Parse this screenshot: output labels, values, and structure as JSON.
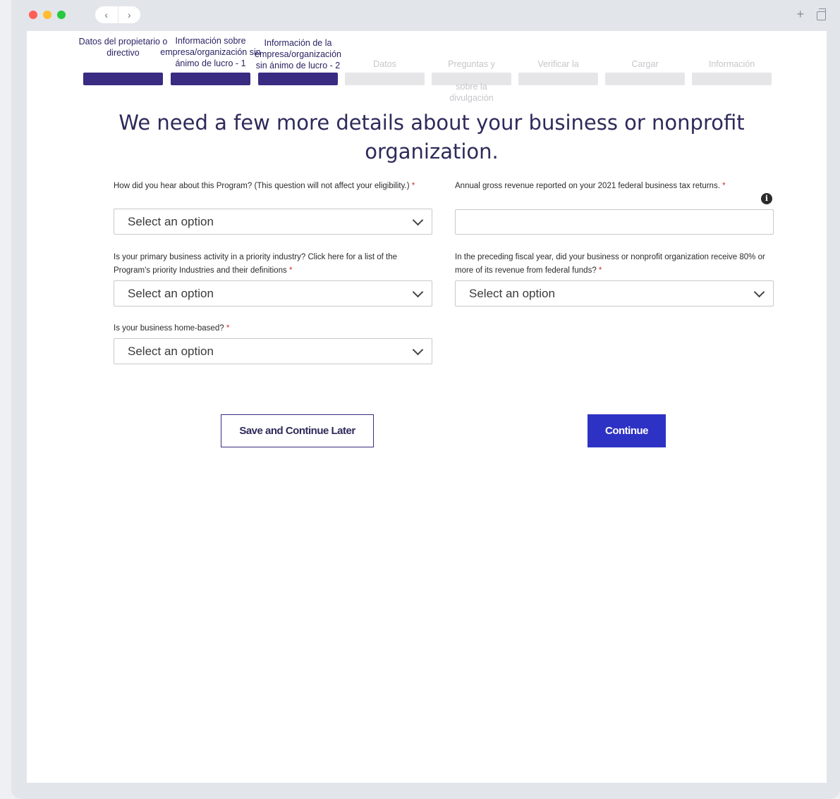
{
  "browser": {
    "back_icon": "chevron-left",
    "forward_icon": "chevron-right",
    "new_tab_icon": "plus",
    "tabs_icon": "tabs-overview"
  },
  "stepper": {
    "steps": [
      {
        "label": "Datos del propietario o directivo",
        "state": "completed"
      },
      {
        "label": "Información sobre empresa/organización sin ánimo de lucro - 1",
        "state": "completed"
      },
      {
        "label": "Información de la empresa/organización sin ánimo de lucro - 2",
        "state": "current"
      },
      {
        "label": "Datos",
        "state": "upcoming"
      },
      {
        "label": "Preguntas y ... sobre la divulgación",
        "state": "upcoming"
      },
      {
        "label": "Verificar la",
        "state": "upcoming"
      },
      {
        "label": "Cargar",
        "state": "upcoming"
      },
      {
        "label": "Información",
        "state": "upcoming"
      }
    ],
    "step5_line1": "Preguntas y",
    "step5_line2": "sobre la",
    "step5_line3": "divulgación",
    "active_color": "#3a2b82",
    "inactive_color": "#e6e6e9"
  },
  "form": {
    "title": "We need a few more details about your business or nonprofit organization.",
    "hear_about": {
      "label": "How did you hear about this Program? (This question will not affect your eligibility.)",
      "required_mark": "*",
      "value": "Select an option"
    },
    "gross_revenue": {
      "label": "Annual gross revenue reported on your 2021 federal business tax returns.",
      "required_mark": "*",
      "value": "",
      "info_icon": "info-circle"
    },
    "priority_industry": {
      "label": "Is your primary business activity in a priority industry? Click here for a list of the Program's priority Industries and their definitions",
      "required_mark": "*",
      "value": "Select an option"
    },
    "federal_funds": {
      "label": "In the preceding fiscal year, did your business or nonprofit organization receive 80% or more of its revenue from federal funds?",
      "required_mark": "*",
      "value": "Select an option"
    },
    "home_based": {
      "label": "Is your business home-based?",
      "required_mark": "*",
      "value": "Select an option"
    }
  },
  "actions": {
    "save_later": "Save and Continue Later",
    "continue": "Continue",
    "primary_color": "#2e32c4"
  }
}
